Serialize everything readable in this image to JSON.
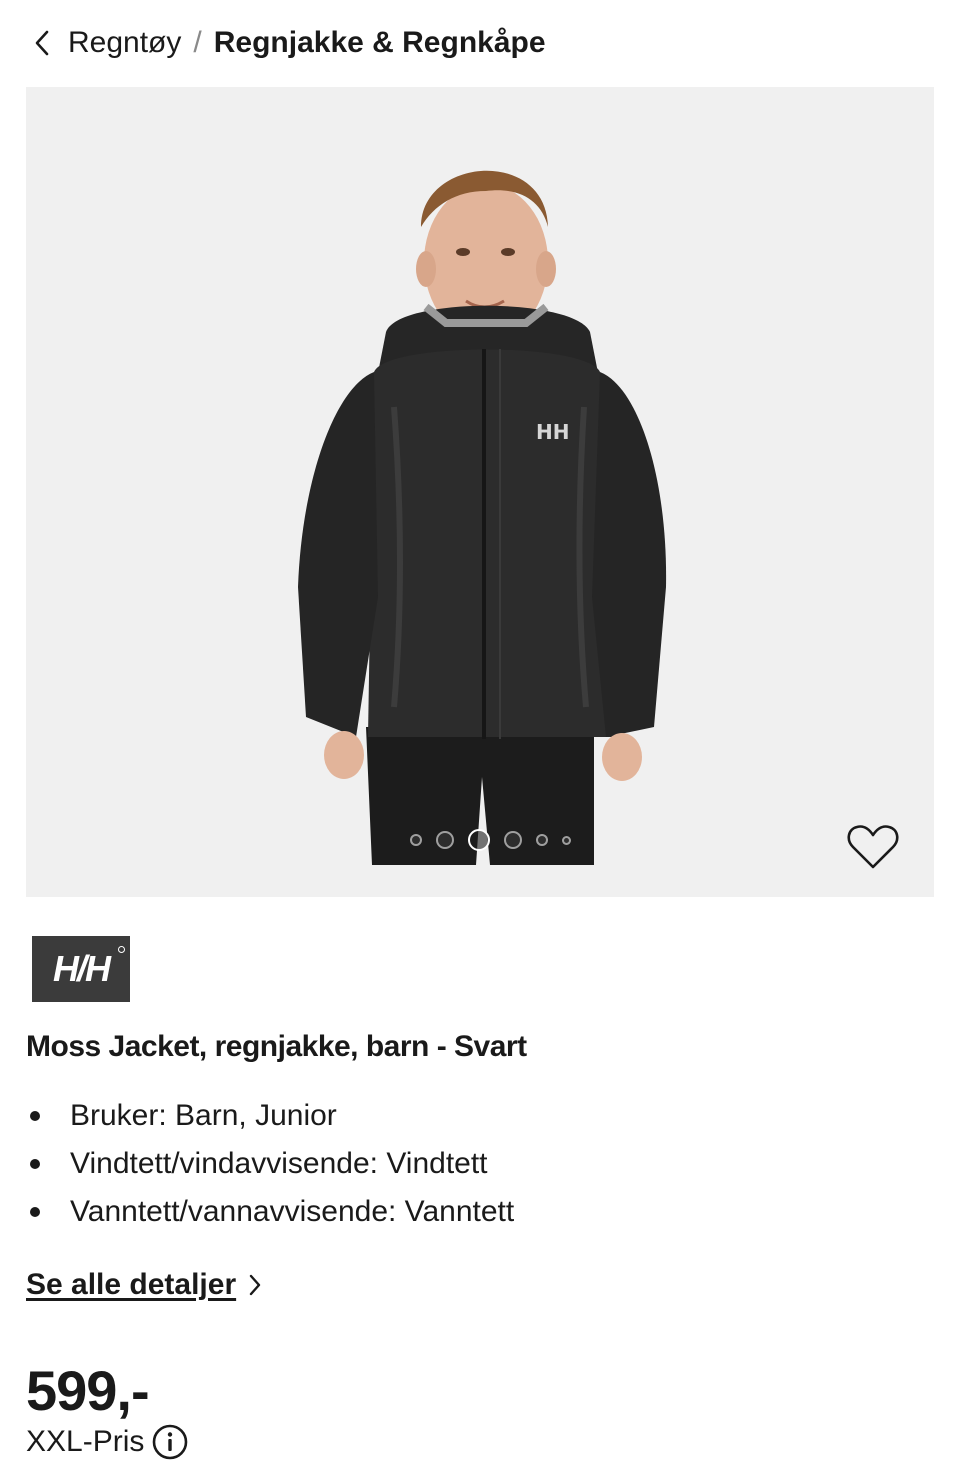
{
  "breadcrumb": {
    "parent": "Regntøy",
    "separator": "/",
    "current": "Regnjakke & Regnkåpe"
  },
  "gallery": {
    "image_count": 6,
    "active_index": 2
  },
  "brand": {
    "logo_text": "H/H"
  },
  "product": {
    "title": "Moss Jacket, regnjakke, barn - Svart",
    "features": [
      "Bruker: Barn, Junior",
      "Vindtett/vindavvisende: Vindtett",
      "Vanntett/vannavvisende: Vanntett"
    ],
    "details_link": "Se alle detaljer",
    "price": "599,-",
    "price_type": "XXL-Pris"
  },
  "icons": {
    "back": "chevron-left-icon",
    "favorite": "heart-icon",
    "details": "chevron-right-icon",
    "info": "info-icon"
  },
  "colors": {
    "text": "#1a1a1a",
    "gallery_bg": "#f0f0f0",
    "logo_bg": "#3b3b3b"
  }
}
